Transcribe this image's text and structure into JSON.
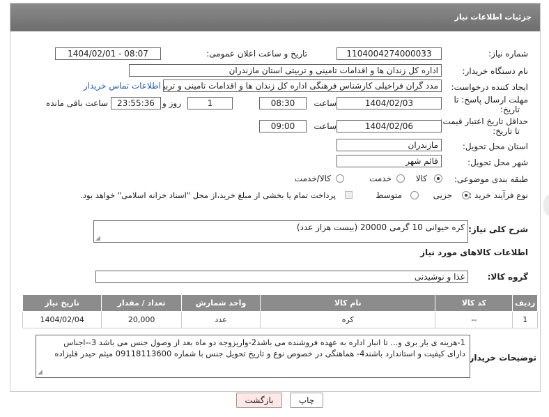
{
  "header": {
    "title": "جزئیات اطلاعات نیاز"
  },
  "fields": {
    "need_number": {
      "label": "شماره نیاز:",
      "value": "1104004274000033"
    },
    "announce": {
      "label": "تاریخ و ساعت اعلان عمومی:",
      "value": "1404/02/01 - 08:07"
    },
    "buyer_org": {
      "label": "نام دستگاه خریدار:",
      "value": "اداره کل زندان ها و اقدامات تامینی و تربیتی استان مازندران"
    },
    "requester": {
      "label": "ایجاد کننده درخواست:",
      "value": "مدد گران فراخیلی کارشناس فرهنگی اداره کل زندان ها و اقدامات تامینی و تربیت",
      "contact_link": "اطلاعات تماس خریدار"
    },
    "reply_deadline": {
      "label_line1": "مهلت ارسال پاسخ: تا",
      "label_line2": "تاریخ:",
      "date": "1404/02/03",
      "time_label": "ساعت",
      "time": "08:30",
      "days": "1",
      "days_label": "روز و",
      "remaining": "23:55:36",
      "remaining_label": "ساعت باقی مانده"
    },
    "price_deadline": {
      "label_line1": "حداقل تاریخ اعتبار قیمت:",
      "label_line2": "تا تاریخ:",
      "date": "1404/02/06",
      "time_label": "ساعت",
      "time": "09:00"
    },
    "province": {
      "label": "استان محل تحویل:",
      "value": "مازندران"
    },
    "city": {
      "label": "شهر محل تحویل:",
      "value": "قائم شهر"
    },
    "category": {
      "label": "طبقه بندی موضوعی:",
      "options": [
        "کالا",
        "خدمت",
        "کالا/خدمت"
      ],
      "selected": "کالا"
    },
    "process": {
      "label": "نوع فرآیند خرید :",
      "options": [
        "جزیی",
        "متوسط"
      ],
      "selected": "جزیی",
      "payment_note": "پرداخت تمام یا بخشی از مبلغ خرید،از محل \"اسناد خزانه اسلامی\" خواهد بود."
    }
  },
  "summary": {
    "label": "شرح کلی نیاز:",
    "value": "کره حیوانی 10 گرمی 20000 (بیست هزار عدد)"
  },
  "items_section": {
    "title": "اطلاعات کالاهای مورد نیاز"
  },
  "goods_group": {
    "label": "گروه کالا:",
    "value": "غذا و نوشیدنی"
  },
  "table": {
    "headers": [
      "ردیف",
      "کد کالا",
      "نام کالا",
      "واحد شمارش",
      "تعداد / مقدار",
      "تاریخ نیاز"
    ],
    "rows": [
      [
        "1",
        "--",
        "کره",
        "عدد",
        "20,000",
        "1404/02/04"
      ]
    ]
  },
  "buyer_notes": {
    "label": "توضیحات خریدار:",
    "line1": "1-هزینه ی بار بری و... تا انبار اداره به عهده فروشنده می باشد2-واریزوجه دو ماه بعد از وصول جنس می باشد 3--اجناس",
    "line2": "دارای کیفیت و استاندارد باشند4- هماهنگی در خصوص نوع و تاریخ تحویل جنس با شماره 09118113600 میثم حیدر قلیزاده"
  },
  "buttons": {
    "print": "چاپ",
    "back": "بازگشت"
  },
  "colors": {
    "header": "#7a7a7a",
    "table_header": "#8c8c8c",
    "link": "#1a5fb4",
    "back_button_bg": "#fde7e7"
  }
}
